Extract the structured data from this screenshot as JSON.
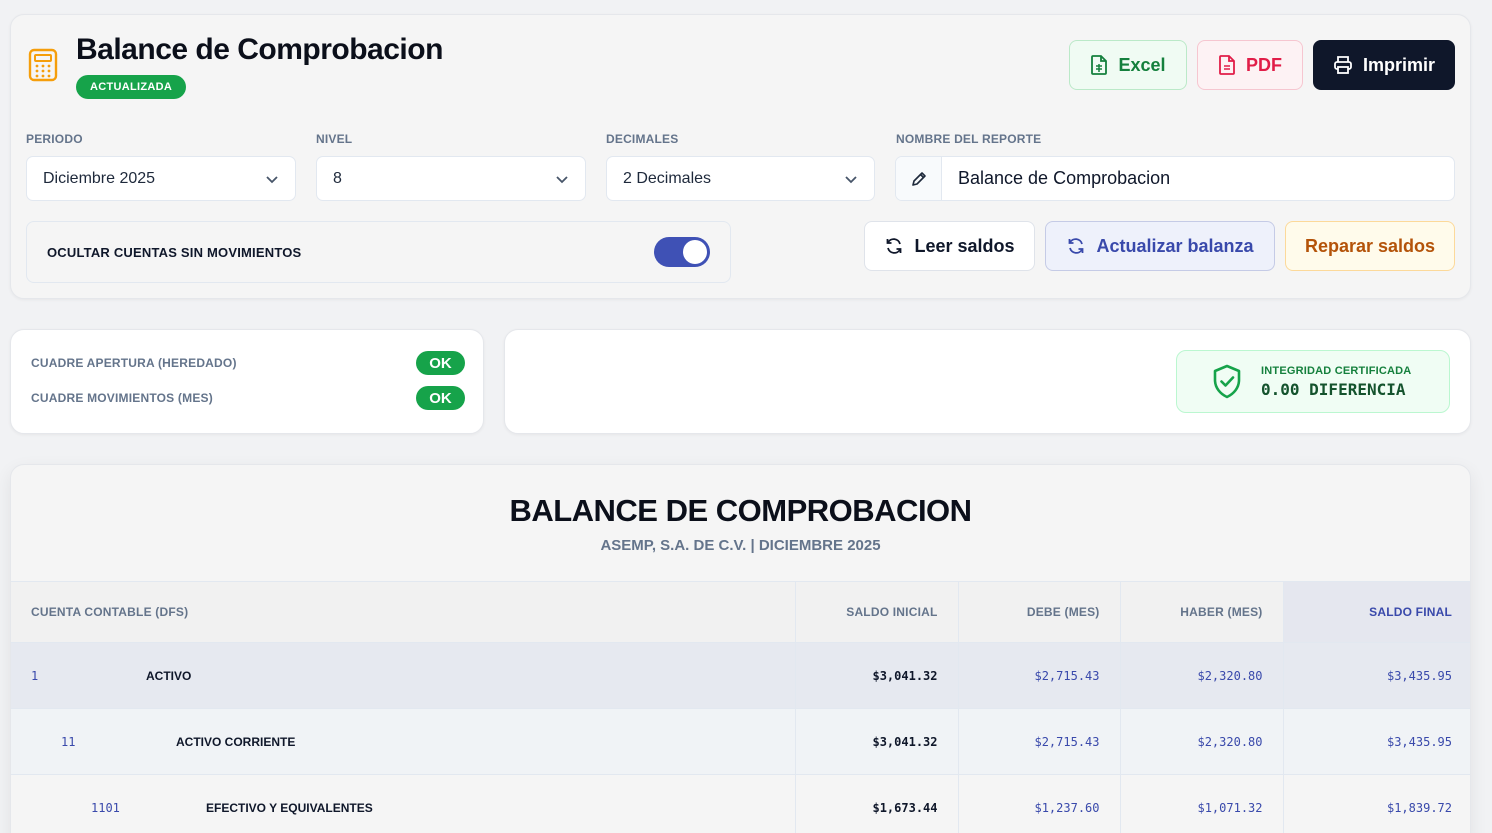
{
  "header": {
    "title": "Balance de Comprobacion",
    "status_badge": "ACTUALIZADA",
    "excel_label": "Excel",
    "pdf_label": "PDF",
    "print_label": "Imprimir"
  },
  "filters": {
    "periodo_label": "PERIODO",
    "periodo_value": "Diciembre 2025",
    "nivel_label": "NIVEL",
    "nivel_value": "8",
    "decimales_label": "DECIMALES",
    "decimales_value": "2 Decimales",
    "nombre_label": "NOMBRE DEL REPORTE",
    "nombre_value": "Balance de Comprobacion"
  },
  "toggle": {
    "label": "OCULTAR CUENTAS SIN MOVIMIENTOS",
    "on": true
  },
  "actions": {
    "leer_label": "Leer saldos",
    "actualizar_label": "Actualizar balanza",
    "reparar_label": "Reparar saldos"
  },
  "checks": [
    {
      "label": "CUADRE APERTURA (HEREDADO)",
      "status": "OK"
    },
    {
      "label": "CUADRE MOVIMIENTOS (MES)",
      "status": "OK"
    }
  ],
  "integrity": {
    "label": "INTEGRIDAD CERTIFICADA",
    "value": "0.00 DIFERENCIA"
  },
  "report": {
    "title": "BALANCE DE COMPROBACION",
    "subtitle": "ASEMP, S.A. DE C.V. | DICIEMBRE 2025",
    "columns": [
      "CUENTA CONTABLE (DFS)",
      "SALDO INICIAL",
      "DEBE (MES)",
      "HABER (MES)",
      "SALDO FINAL"
    ],
    "rows": [
      {
        "code": "1",
        "name": "ACTIVO",
        "level": 1,
        "saldo_inicial": "$3,041.32",
        "debe": "$2,715.43",
        "haber": "$2,320.80",
        "saldo_final": "$3,435.95"
      },
      {
        "code": "11",
        "name": "ACTIVO CORRIENTE",
        "level": 2,
        "saldo_inicial": "$3,041.32",
        "debe": "$2,715.43",
        "haber": "$2,320.80",
        "saldo_final": "$3,435.95"
      },
      {
        "code": "1101",
        "name": "EFECTIVO Y EQUIVALENTES",
        "level": 3,
        "saldo_inicial": "$1,673.44",
        "debe": "$1,237.60",
        "haber": "$1,071.32",
        "saldo_final": "$1,839.72"
      }
    ]
  },
  "colors": {
    "accent": "#3f51b5",
    "success": "#16a34a",
    "danger": "#e11d48",
    "warning": "#b45309",
    "dark": "#0f172a"
  }
}
